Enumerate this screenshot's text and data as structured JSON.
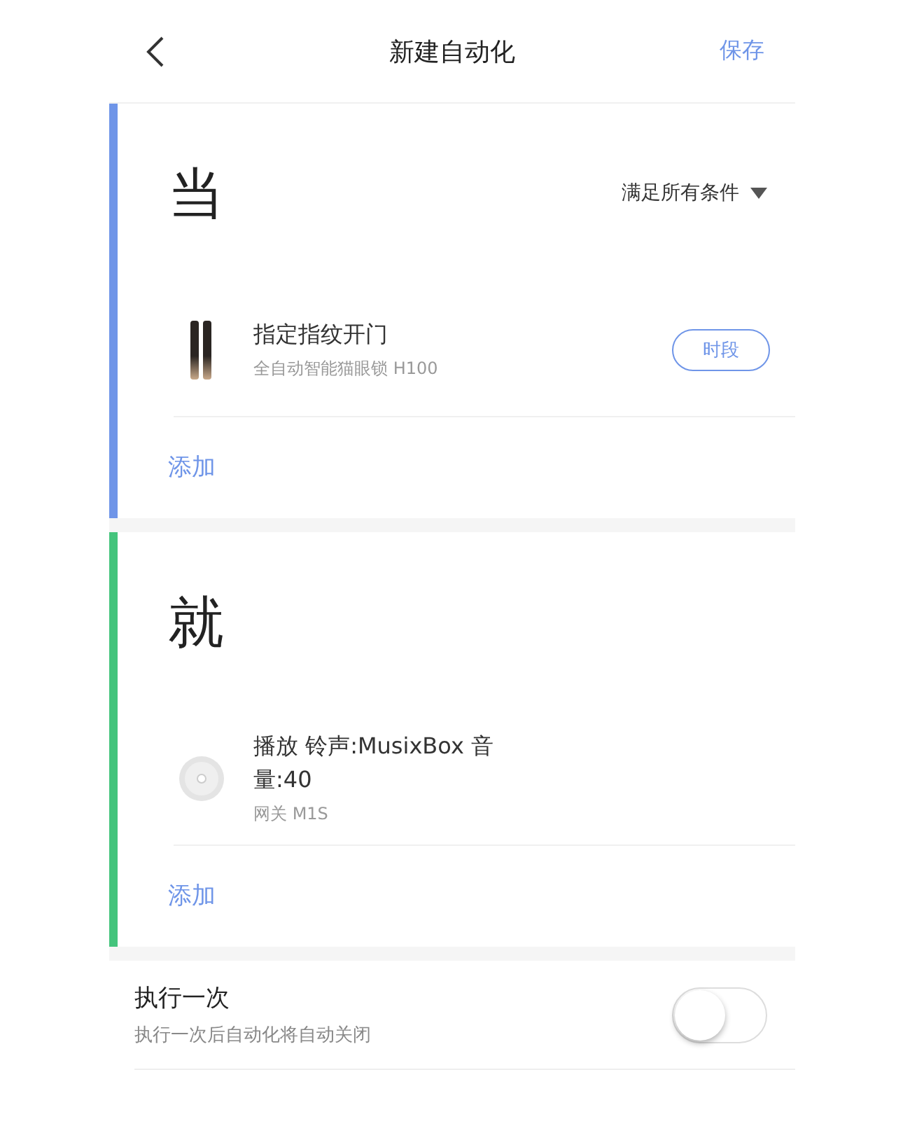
{
  "header": {
    "title": "新建自动化",
    "action": "保存"
  },
  "sections": [
    {
      "heading": "当",
      "color": "#6f95e8",
      "condition": "满足所有条件",
      "items": [
        {
          "kind": "lock",
          "title": "指定指纹开门",
          "subtitle": "全自动智能猫眼锁 H100",
          "button": "时段"
        }
      ],
      "add": "添加"
    },
    {
      "heading": "就",
      "color": "#44c47c",
      "items": [
        {
          "kind": "gateway",
          "title": "播放 铃声:MusixBox 音量:40",
          "subtitle": "网关 M1S"
        }
      ],
      "add": "添加"
    }
  ],
  "option": {
    "title": "执行一次",
    "subtitle": "执行一次后自动化将自动关闭",
    "on": false
  }
}
